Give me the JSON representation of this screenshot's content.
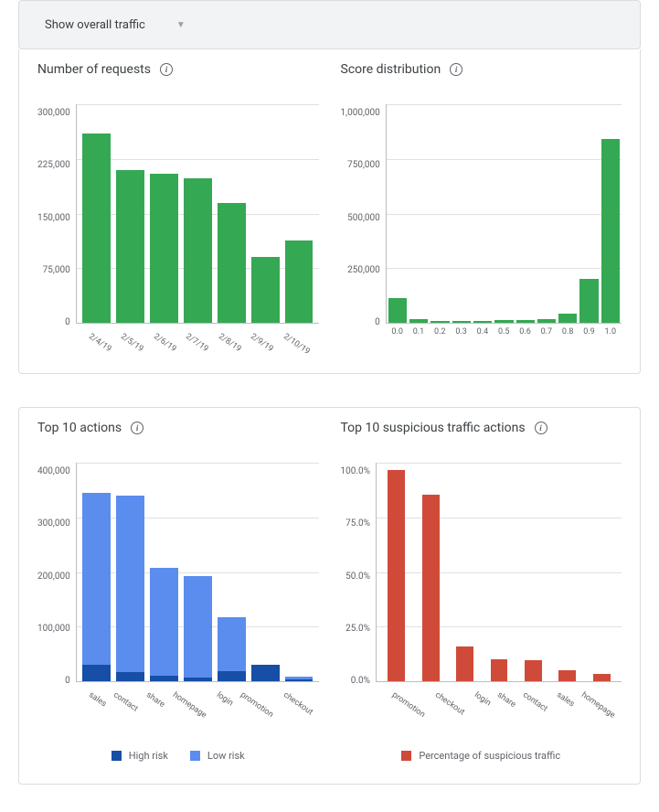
{
  "colors": {
    "green": "#34a853",
    "darkblue": "#174ea6",
    "lightblue": "#5a8dee",
    "red": "#d04a3a"
  },
  "dropdown": {
    "label": "Show overall traffic"
  },
  "charts": {
    "requests": {
      "title": "Number of requests",
      "ymax": 300000,
      "yticks": [
        "300,000",
        "225,000",
        "150,000",
        "75,000",
        "0"
      ],
      "bars": [
        {
          "label": "2/4/19",
          "v": 260000
        },
        {
          "label": "2/5/19",
          "v": 210000
        },
        {
          "label": "2/6/19",
          "v": 205000
        },
        {
          "label": "2/7/19",
          "v": 198000
        },
        {
          "label": "2/8/19",
          "v": 165000
        },
        {
          "label": "2/9/19",
          "v": 90000
        },
        {
          "label": "2/10/19",
          "v": 113000
        }
      ]
    },
    "score": {
      "title": "Score distribution",
      "ymax": 1000000,
      "yticks": [
        "1,000,000",
        "750,000",
        "500,000",
        "250,000",
        "0"
      ],
      "bars": [
        {
          "label": "0.0",
          "v": 115000
        },
        {
          "label": "0.1",
          "v": 15000
        },
        {
          "label": "0.2",
          "v": 10000
        },
        {
          "label": "0.3",
          "v": 8000
        },
        {
          "label": "0.4",
          "v": 9000
        },
        {
          "label": "0.5",
          "v": 12000
        },
        {
          "label": "0.6",
          "v": 14000
        },
        {
          "label": "0.7",
          "v": 18000
        },
        {
          "label": "0.8",
          "v": 40000
        },
        {
          "label": "0.9",
          "v": 200000
        },
        {
          "label": "1.0",
          "v": 840000
        }
      ]
    },
    "actions": {
      "title": "Top 10 actions",
      "ymax": 400000,
      "yticks": [
        "400,000",
        "300,000",
        "200,000",
        "100,000",
        "0"
      ],
      "legend": {
        "high": "High risk",
        "low": "Low risk"
      },
      "bars": [
        {
          "label": "sales",
          "high": 30000,
          "low": 315000
        },
        {
          "label": "contact",
          "high": 16000,
          "low": 324000
        },
        {
          "label": "share",
          "high": 10000,
          "low": 198000
        },
        {
          "label": "homepage",
          "high": 6000,
          "low": 186000
        },
        {
          "label": "login",
          "high": 18000,
          "low": 100000
        },
        {
          "label": "promotion",
          "high": 30000,
          "low": 0
        },
        {
          "label": "checkout",
          "high": 4000,
          "low": 4000
        }
      ]
    },
    "suspicious": {
      "title": "Top 10 suspicious traffic actions",
      "ymax": 100,
      "yticks": [
        "100.0%",
        "75.0%",
        "50.0%",
        "25.0%",
        "0.0%"
      ],
      "legend": {
        "pct": "Percentage of suspicious traffic"
      },
      "bars": [
        {
          "label": "promotion",
          "v": 96.5
        },
        {
          "label": "checkout",
          "v": 85.5
        },
        {
          "label": "login",
          "v": 16.0
        },
        {
          "label": "share",
          "v": 10.0
        },
        {
          "label": "contact",
          "v": 9.5
        },
        {
          "label": "sales",
          "v": 5.0
        },
        {
          "label": "homepage",
          "v": 3.5
        }
      ]
    }
  },
  "chart_data": [
    {
      "type": "bar",
      "title": "Number of requests",
      "categories": [
        "2/4/19",
        "2/5/19",
        "2/6/19",
        "2/7/19",
        "2/8/19",
        "2/9/19",
        "2/10/19"
      ],
      "values": [
        260000,
        210000,
        205000,
        198000,
        165000,
        90000,
        113000
      ],
      "ylim": [
        0,
        300000
      ],
      "ylabel": "",
      "xlabel": ""
    },
    {
      "type": "bar",
      "title": "Score distribution",
      "categories": [
        "0.0",
        "0.1",
        "0.2",
        "0.3",
        "0.4",
        "0.5",
        "0.6",
        "0.7",
        "0.8",
        "0.9",
        "1.0"
      ],
      "values": [
        115000,
        15000,
        10000,
        8000,
        9000,
        12000,
        14000,
        18000,
        40000,
        200000,
        840000
      ],
      "ylim": [
        0,
        1000000
      ],
      "ylabel": "",
      "xlabel": ""
    },
    {
      "type": "bar",
      "title": "Top 10 actions",
      "categories": [
        "sales",
        "contact",
        "share",
        "homepage",
        "login",
        "promotion",
        "checkout"
      ],
      "series": [
        {
          "name": "High risk",
          "values": [
            30000,
            16000,
            10000,
            6000,
            18000,
            30000,
            4000
          ]
        },
        {
          "name": "Low risk",
          "values": [
            315000,
            324000,
            198000,
            186000,
            100000,
            0,
            4000
          ]
        }
      ],
      "stacked": true,
      "ylim": [
        0,
        400000
      ],
      "ylabel": "",
      "xlabel": ""
    },
    {
      "type": "bar",
      "title": "Top 10 suspicious traffic actions",
      "categories": [
        "promotion",
        "checkout",
        "login",
        "share",
        "contact",
        "sales",
        "homepage"
      ],
      "series": [
        {
          "name": "Percentage of suspicious traffic",
          "values": [
            96.5,
            85.5,
            16.0,
            10.0,
            9.5,
            5.0,
            3.5
          ]
        }
      ],
      "ylim": [
        0,
        100
      ],
      "ylabel": "%",
      "xlabel": ""
    }
  ]
}
